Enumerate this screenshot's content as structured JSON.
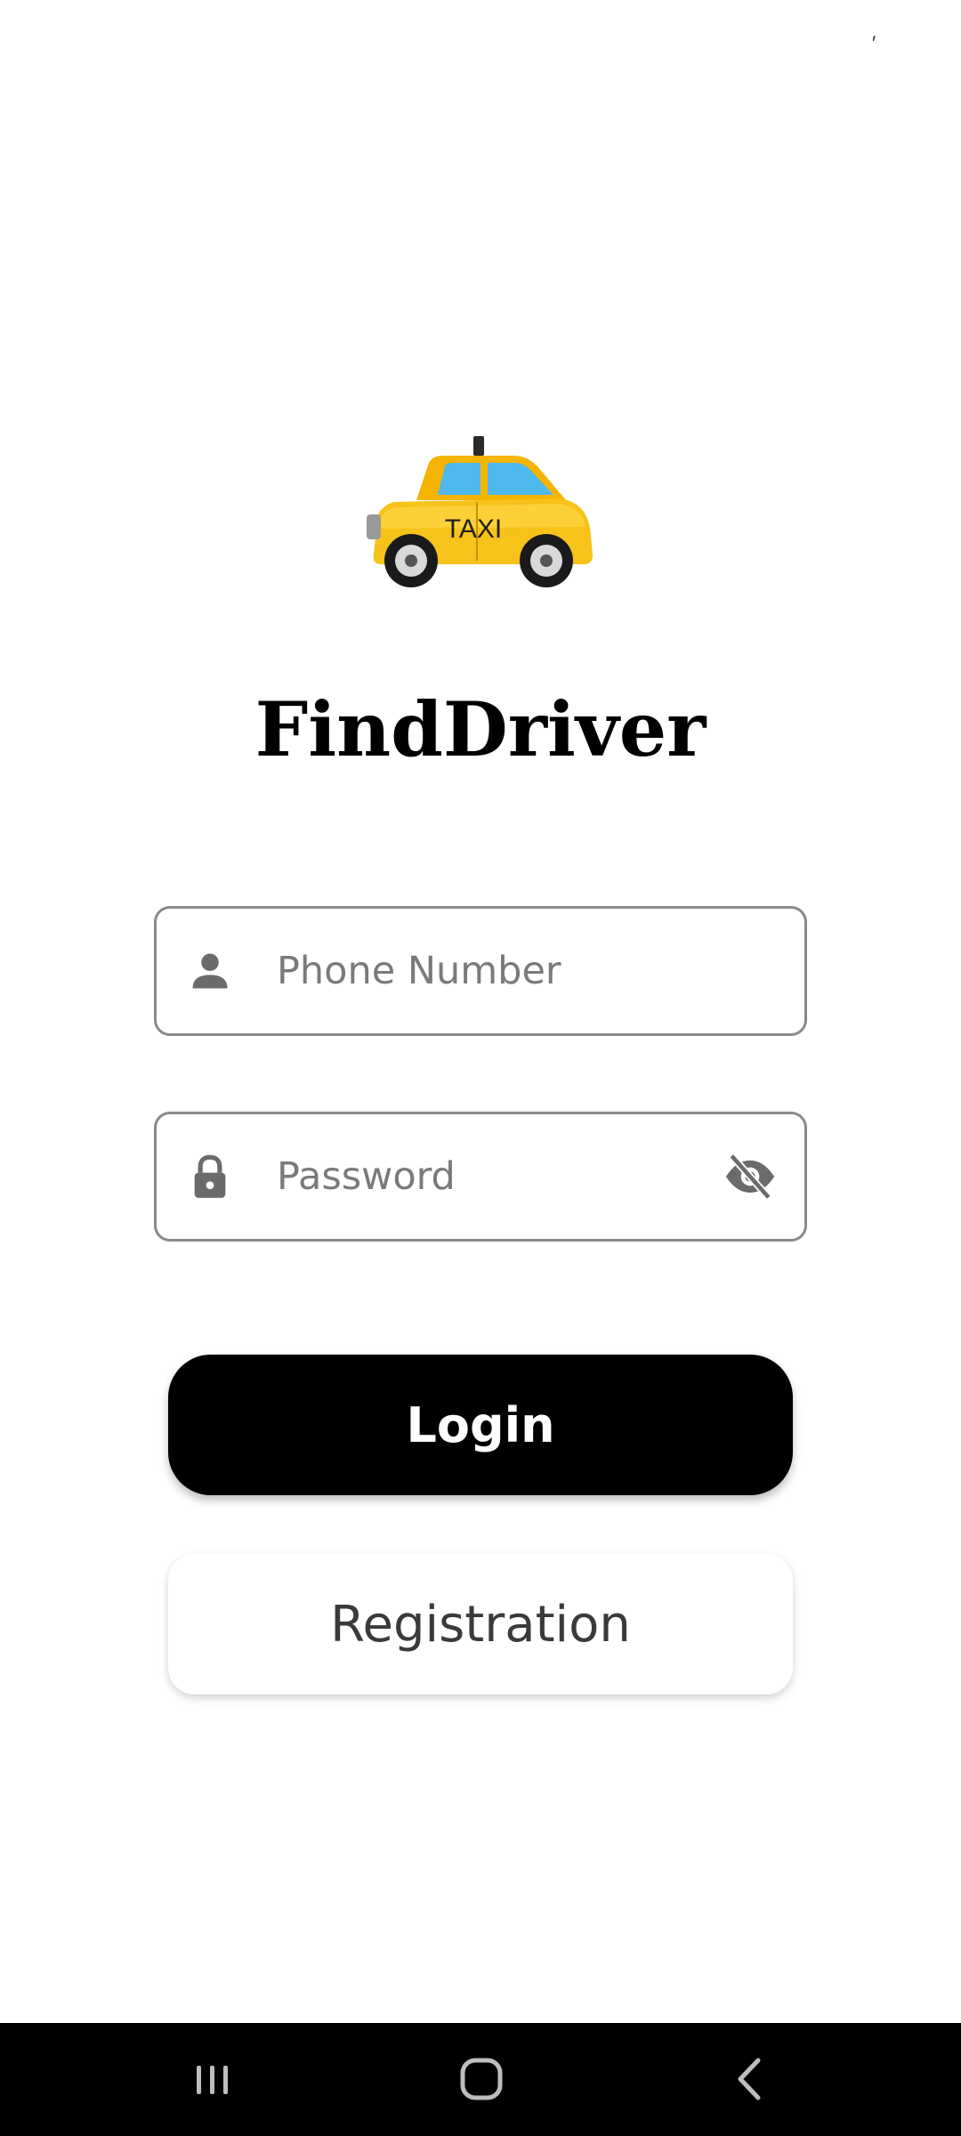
{
  "status": {
    "corner_mark": "′"
  },
  "app": {
    "title": "FindDriver",
    "logo_text": "TAXI",
    "logo_icon": "taxi-icon"
  },
  "form": {
    "phone": {
      "placeholder": "Phone Number",
      "icon": "person-icon"
    },
    "password": {
      "placeholder": "Password",
      "icon": "lock-icon",
      "toggle_icon": "eye-off-icon"
    }
  },
  "buttons": {
    "login_label": "Login",
    "register_label": "Registration"
  },
  "navbar": {
    "items": [
      "recents-icon",
      "home-icon",
      "back-icon"
    ]
  },
  "colors": {
    "accent": "#000000",
    "taxi_yellow": "#F7C21A",
    "field_border": "#8A8A8A",
    "placeholder": "#7A7A7A"
  }
}
